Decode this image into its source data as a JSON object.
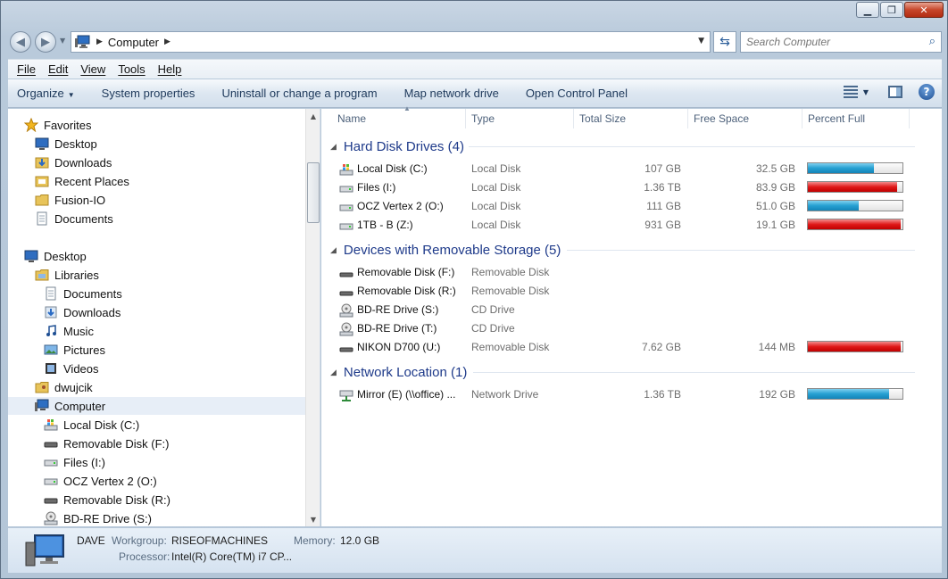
{
  "address": {
    "crumb": "Computer",
    "search_placeholder": "Search Computer"
  },
  "menu": [
    "File",
    "Edit",
    "View",
    "Tools",
    "Help"
  ],
  "commands": {
    "organize": "Organize",
    "system_properties": "System properties",
    "uninstall": "Uninstall or change a program",
    "map_drive": "Map network drive",
    "control_panel": "Open Control Panel"
  },
  "nav": {
    "favorites": "Favorites",
    "fav_desktop": "Desktop",
    "fav_downloads": "Downloads",
    "fav_recent": "Recent Places",
    "fav_fusion": "Fusion-IO",
    "fav_documents": "Documents",
    "desktop": "Desktop",
    "libraries": "Libraries",
    "lib_documents": "Documents",
    "lib_downloads": "Downloads",
    "lib_music": "Music",
    "lib_pictures": "Pictures",
    "lib_videos": "Videos",
    "user": "dwujcik",
    "computer": "Computer",
    "c_local": "Local Disk (C:)",
    "c_remf": "Removable Disk (F:)",
    "c_files": "Files (I:)",
    "c_ocz": "OCZ Vertex 2 (O:)",
    "c_remr": "Removable Disk (R:)",
    "c_bdre": "BD-RE Drive (S:)"
  },
  "columns": {
    "name": "Name",
    "type": "Type",
    "total": "Total Size",
    "free": "Free Space",
    "percent": "Percent Full"
  },
  "groups": {
    "hdd": "Hard Disk Drives (4)",
    "removable": "Devices with Removable Storage (5)",
    "network": "Network Location (1)"
  },
  "rows": [
    {
      "name": "Local Disk (C:)",
      "type": "Local Disk",
      "total": "107 GB",
      "free": "32.5 GB",
      "percent_full": 0.7,
      "bar": "blue",
      "icon": "windows-drive-icon"
    },
    {
      "name": "Files (I:)",
      "type": "Local Disk",
      "total": "1.36 TB",
      "free": "83.9 GB",
      "percent_full": 0.94,
      "bar": "red",
      "icon": "hard-drive-icon"
    },
    {
      "name": "OCZ Vertex 2 (O:)",
      "type": "Local Disk",
      "total": "111 GB",
      "free": "51.0 GB",
      "percent_full": 0.54,
      "bar": "blue",
      "icon": "hard-drive-icon"
    },
    {
      "name": "1TB - B (Z:)",
      "type": "Local Disk",
      "total": "931 GB",
      "free": "19.1 GB",
      "percent_full": 0.98,
      "bar": "red",
      "icon": "hard-drive-icon"
    },
    {
      "name": "Removable Disk (F:)",
      "type": "Removable Disk",
      "total": "",
      "free": "",
      "icon": "removable-disk-icon"
    },
    {
      "name": "Removable Disk (R:)",
      "type": "Removable Disk",
      "total": "",
      "free": "",
      "icon": "removable-disk-icon"
    },
    {
      "name": "BD-RE Drive (S:)",
      "type": "CD Drive",
      "total": "",
      "free": "",
      "icon": "optical-drive-icon"
    },
    {
      "name": "BD-RE Drive (T:)",
      "type": "CD Drive",
      "total": "",
      "free": "",
      "icon": "optical-drive-icon"
    },
    {
      "name": "NIKON D700 (U:)",
      "type": "Removable Disk",
      "total": "7.62 GB",
      "free": "144 MB",
      "percent_full": 0.98,
      "bar": "red",
      "icon": "removable-disk-icon"
    },
    {
      "name": "Mirror (E) (\\\\office) ...",
      "type": "Network Drive",
      "total": "1.36 TB",
      "free": "192 GB",
      "percent_full": 0.86,
      "bar": "blue",
      "icon": "network-drive-icon"
    }
  ],
  "details": {
    "computer_name": "DAVE",
    "workgroup_label": "Workgroup:",
    "workgroup": "RISEOFMACHINES",
    "memory_label": "Memory:",
    "memory": "12.0 GB",
    "processor_label": "Processor:",
    "processor": "Intel(R) Core(TM) i7 CP..."
  },
  "colors": {
    "bar_blue": "#26a0d2",
    "bar_red": "#e01919",
    "group_title": "#1e3a8a"
  }
}
